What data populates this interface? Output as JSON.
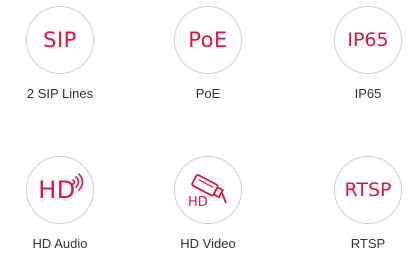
{
  "features": [
    {
      "icon_text": "SIP",
      "label": "2 SIP Lines"
    },
    {
      "icon_text": "PoE",
      "label": "PoE"
    },
    {
      "icon_text": "IP65",
      "label": "IP65"
    },
    {
      "icon_text": "HD",
      "label": "HD Audio",
      "icon": "hd-audio-icon"
    },
    {
      "icon_text": "HD",
      "label": "HD Video",
      "icon": "camera-icon"
    },
    {
      "icon_text": "RTSP",
      "label": "RTSP"
    }
  ],
  "colors": {
    "accent": "#e0143c",
    "ring": "#cfcfcf",
    "label": "#333333"
  }
}
